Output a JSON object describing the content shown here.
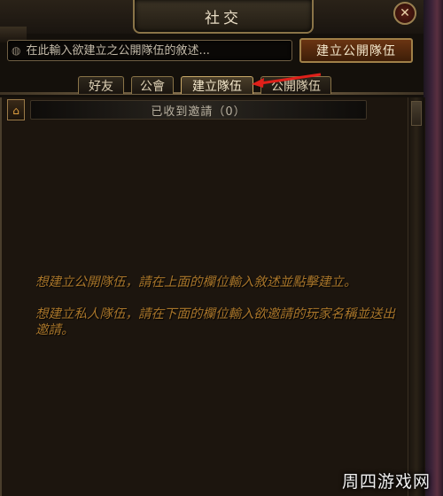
{
  "window": {
    "title": "社交",
    "close_icon": "close-icon"
  },
  "search": {
    "placeholder": "在此輸入欲建立之公開隊伍的敘述...",
    "value": "",
    "icon": "globe-icon",
    "create_button_label": "建立公開隊伍"
  },
  "tabs": [
    {
      "label": "好友",
      "active": false
    },
    {
      "label": "公會",
      "active": false
    },
    {
      "label": "建立隊伍",
      "active": true
    },
    {
      "label": "公開隊伍",
      "active": false
    }
  ],
  "invites": {
    "label": "已收到邀請（0）"
  },
  "hints": {
    "public": "想建立公開隊伍，請在上面的欄位輸入敘述並點擊建立。",
    "private": "想建立私人隊伍，請在下面的欄位輸入欲邀請的玩家名稱並送出邀請。"
  },
  "watermark": "周四游戏网",
  "colors": {
    "hint_text": "#a8752a",
    "accent_button": "#6a3412",
    "annotation_arrow": "#e0201a"
  }
}
